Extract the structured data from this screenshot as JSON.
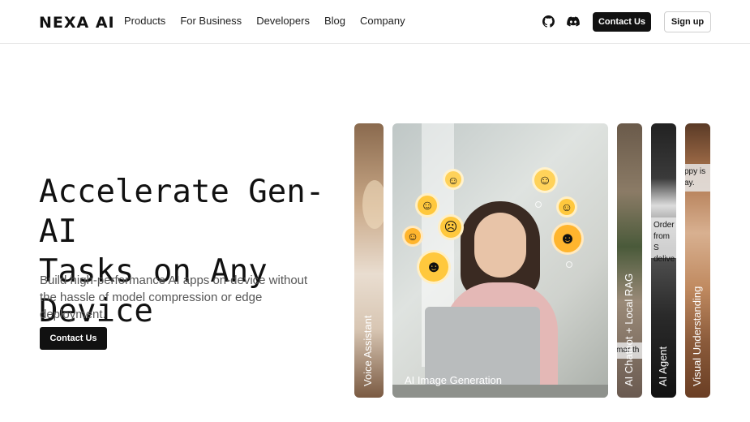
{
  "header": {
    "logo": "NEXA AI",
    "nav": [
      "Products",
      "For Business",
      "Developers",
      "Blog",
      "Company"
    ],
    "icons": [
      "github-icon",
      "discord-icon"
    ],
    "contact_label": "Contact Us",
    "signup_label": "Sign up"
  },
  "hero": {
    "title_line1": "Accelerate Gen-AI",
    "title_line2": "Tasks on Any Device",
    "subtitle": "Build high-performance AI apps on-device without the hassle of model compression or edge deployment.",
    "cta_label": "Contact Us"
  },
  "cards": {
    "voice": "Voice Assistant",
    "image_gen": "AI Image Generation",
    "chatbot": "AI Chatbot + Local RAG",
    "chatbot_snippet": "mar th",
    "agent": "AI Agent",
    "agent_snippet_l1": "Order",
    "agent_snippet_l2": "from S",
    "agent_snippet_l3": "delive",
    "visual": "Visual Understanding",
    "visual_snippet_l1": "ppy is",
    "visual_snippet_l2": "ay."
  },
  "colors": {
    "accent": "#111111",
    "border": "#e6e6e6"
  }
}
